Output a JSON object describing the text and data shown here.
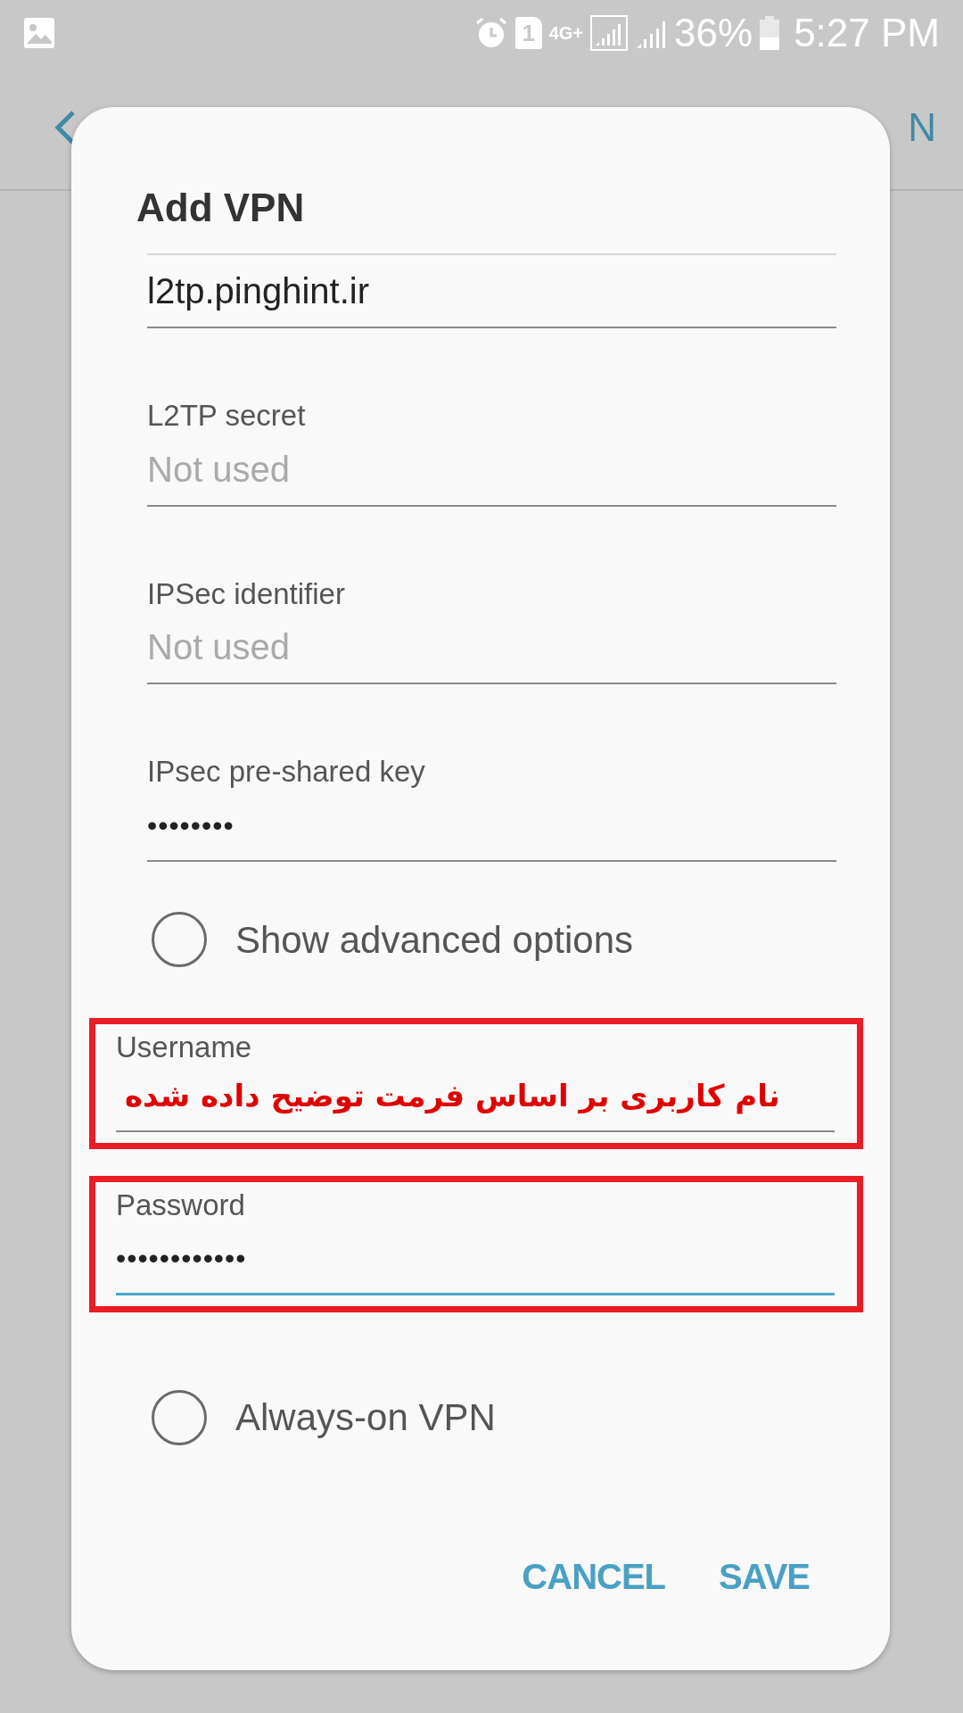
{
  "status_bar": {
    "battery": "36%",
    "time": "5:27 PM",
    "sim": "1",
    "network": "4G+"
  },
  "background": {
    "action_fragment": "N"
  },
  "dialog": {
    "title": "Add VPN",
    "fields": [
      {
        "kind": "text",
        "value": "l2tp.pinghint.ir",
        "highlighted": false,
        "focused": false
      },
      {
        "kind": "text",
        "label": "L2TP secret",
        "placeholder": "Not used",
        "highlighted": false,
        "focused": false
      },
      {
        "kind": "text",
        "label": "IPSec identifier",
        "placeholder": "Not used",
        "highlighted": false,
        "focused": false
      },
      {
        "kind": "password",
        "label": "IPsec pre-shared key",
        "value": "••••••••",
        "highlighted": false,
        "focused": false
      },
      {
        "kind": "checkbox",
        "label": "Show advanced options",
        "checked": false
      },
      {
        "kind": "annotation",
        "label": "Username",
        "value": "نام کاربری بر اساس فرمت توضیح داده شده",
        "highlighted": true,
        "focused": false
      },
      {
        "kind": "password",
        "label": "Password",
        "value": "••••••••••••",
        "highlighted": true,
        "focused": true
      },
      {
        "kind": "checkbox",
        "label": "Always-on VPN",
        "checked": false
      }
    ],
    "buttons": [
      "CANCEL",
      "SAVE"
    ]
  }
}
